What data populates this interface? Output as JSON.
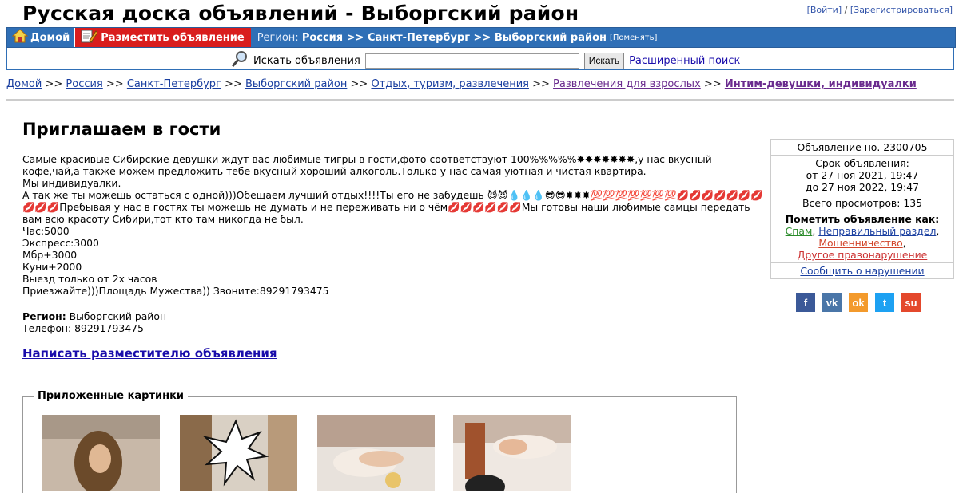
{
  "header": {
    "site_title": "Русская доска объявлений - Выборгский район",
    "login": "[Войти]",
    "separator": "/",
    "register": "[Зарегистрироваться]"
  },
  "nav": {
    "home": "Домой",
    "post_ad": "Разместить объявление",
    "region_label": "Регион:",
    "region_path": "Россия >> Санкт-Петербург >> Выборгский район",
    "change": "[Поменять]"
  },
  "search": {
    "label": "Искать объявления",
    "value": "",
    "button": "Искать",
    "advanced": "Расширенный поиск"
  },
  "breadcrumbs": {
    "items": [
      "Домой",
      "Россия",
      "Санкт-Петербург",
      "Выборгский район",
      "Отдых, туризм, развлечения",
      "Развлечения для взрослых",
      "Интим-девушки, индивидуалки"
    ],
    "sep": ">>"
  },
  "ad": {
    "title": "Приглашаем в гости",
    "lines": [
      "Самые красивые Сибирские девушки ждут вас любимые тигры в гости,фото соответствуют 100%%%%%✸✸✸✸✸✸✸,у нас вкусный",
      "кофе,чай,а также можем предложить тебе вкусный хороший алкоголь.Только у нас самая уютная и чистая квартира.",
      "Мы индивидуалки.",
      "А так же ты можешь остаться с одной)))Обещаем лучший отдых!!!!Ты его не забудешь 😈😈💧💧💧😎😎✸✸✸💯💯💯💯💯💯💯💋💋💋💋💋💋💋",
      "💋💋💋Пребывая у нас в гостях ты можешь не думать и не переживать ни о чём💋💋💋💋💋💋Мы готовы наши любимые самцы передать",
      "вам всю красоту Сибири,тот кто там никогда не был.",
      "Час:5000",
      "Экспресс:3000",
      "Мбр+3000",
      "Куни+2000",
      "Выезд только от 2х часов",
      "Приезжайте)))Площадь Мужества)) Звоните:89291793475"
    ],
    "region_label": "Регион:",
    "region_value": "Выборгский район",
    "phone_label": "Телефон:",
    "phone_value": "89291793475",
    "contact_link": "Написать разместителю объявления"
  },
  "sidebar": {
    "ad_number": "Объявление но. 2300705",
    "term_label": "Срок объявления:",
    "term_from": "от 27 ноя 2021, 19:47",
    "term_to": "до 27 ноя 2022, 19:47",
    "views": "Всего просмотров: 135",
    "mark_title": "Пометить объявление как:",
    "spam": "Спам",
    "comma": ",",
    "wrong_section": "Неправильный раздел",
    "fraud": "Мошенничество",
    "other_violation": "Другое правонарушение",
    "report": "Сообщить о нарушении"
  },
  "social": {
    "icons": [
      "facebook-icon",
      "vkontakte-icon",
      "odnoklassniki-icon",
      "twitter-icon",
      "stumbleupon-icon"
    ],
    "letters": [
      "f",
      "vk",
      "ok",
      "t",
      "su"
    ],
    "colors": [
      "#3b5998",
      "#4a76a8",
      "#f39a2c",
      "#1da1f2",
      "#e4482c"
    ]
  },
  "attachments": {
    "legend": "Приложенные картинки"
  },
  "colors": {
    "nav_blue": "#2f6fb6",
    "post_red": "#d91d1d",
    "link_blue": "#1a0dab"
  }
}
